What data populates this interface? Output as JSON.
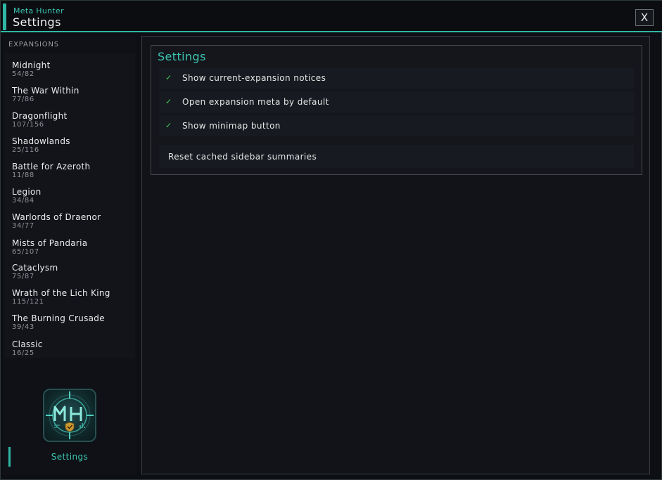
{
  "header": {
    "app_name": "Meta Hunter",
    "title": "Settings",
    "close_label": "X"
  },
  "sidebar": {
    "heading": "EXPANSIONS",
    "expansions": [
      {
        "name": "Midnight",
        "count": "54/82"
      },
      {
        "name": "The War Within",
        "count": "77/86"
      },
      {
        "name": "Dragonflight",
        "count": "107/156"
      },
      {
        "name": "Shadowlands",
        "count": "25/116"
      },
      {
        "name": "Battle for Azeroth",
        "count": "11/88"
      },
      {
        "name": "Legion",
        "count": "34/84"
      },
      {
        "name": "Warlords of Draenor",
        "count": "34/77"
      },
      {
        "name": "Mists of Pandaria",
        "count": "65/107"
      },
      {
        "name": "Cataclysm",
        "count": "75/87"
      },
      {
        "name": "Wrath of the Lich King",
        "count": "115/121"
      },
      {
        "name": "The Burning Crusade",
        "count": "39/43"
      },
      {
        "name": "Classic",
        "count": "16/25"
      }
    ],
    "logo_icon": "meta-hunter-logo",
    "settings_label": "Settings"
  },
  "main": {
    "panel_title": "Settings",
    "options": [
      {
        "label": "Show current-expansion notices",
        "checked": true,
        "icon": "check-icon"
      },
      {
        "label": "Open expansion meta by default",
        "checked": true,
        "icon": "check-icon"
      },
      {
        "label": "Show minimap button",
        "checked": true,
        "icon": "check-icon"
      }
    ],
    "check_glyph": "✓",
    "reset_label": "Reset cached sidebar summaries"
  },
  "colors": {
    "accent": "#2fb7a3",
    "check": "#41c95a",
    "background": "#0d0f14"
  }
}
